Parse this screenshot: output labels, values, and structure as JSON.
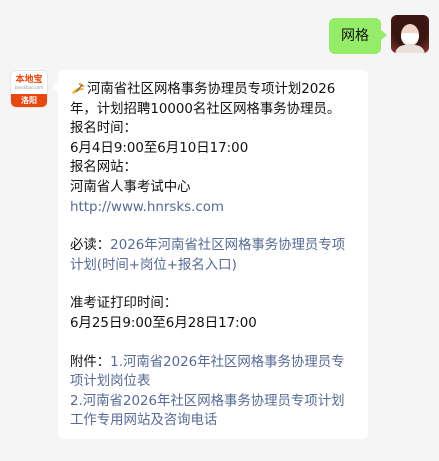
{
  "outgoing": {
    "text": "网格"
  },
  "incoming": {
    "avatar": {
      "brand": "本地宝",
      "domain": "bendibao.com",
      "city": "洛阳"
    },
    "emoji_name": "writing-hand",
    "title_line": "河南省社区网格事务协理员专项计划2026年，计划招聘10000名社区网格事务协理员。",
    "reg_time_label": "报名时间：",
    "reg_time_value": "6月4日9:00至6月10日17:00",
    "reg_site_label": "报名网站：",
    "reg_site_name": "河南省人事考试中心",
    "reg_site_url": "http://www.hnrsks.com",
    "must_read_label": "必读：",
    "must_read_link": "2026年河南省社区网格事务协理员专项计划(时间+岗位+报名入口)",
    "admit_label": "准考证打印时间：",
    "admit_value": "6月25日9:00至6月28日17:00",
    "attach_label": "附件：",
    "attach_1": "1.河南省2026年社区网格事务协理员专项计划岗位表",
    "attach_2": "2.河南省2026年社区网格事务协理员专项计划工作专用网站及咨询电话"
  },
  "colors": {
    "outgoing_bubble": "#95ec69",
    "link": "#576b95",
    "background": "#f5f5f5"
  }
}
